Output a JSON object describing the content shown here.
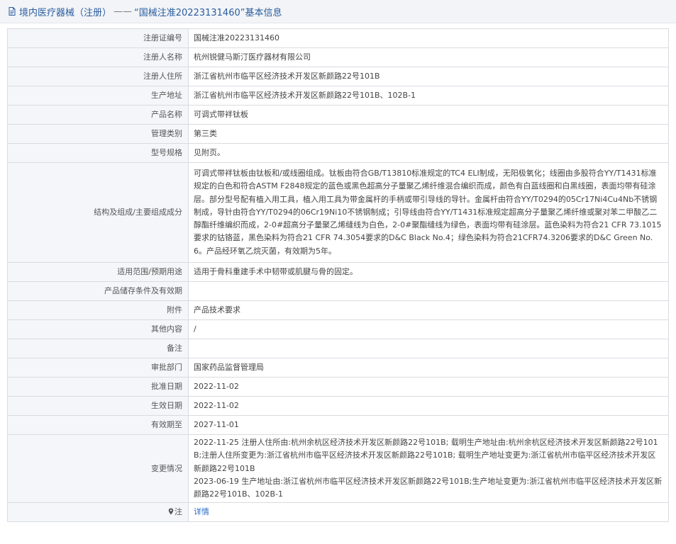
{
  "header": {
    "title": "境内医疗器械（注册）",
    "separator": "——",
    "subtitle": "“国械注准20223131460”基本信息"
  },
  "rows": [
    {
      "label": "注册证编号",
      "value": "国械注准20223131460"
    },
    {
      "label": "注册人名称",
      "value": "杭州锐健马斯汀医疗器材有限公司"
    },
    {
      "label": "注册人住所",
      "value": "浙江省杭州市临平区经济技术开发区新颜路22号101B"
    },
    {
      "label": "生产地址",
      "value": "浙江省杭州市临平区经济技术开发区新颜路22号101B、102B-1"
    },
    {
      "label": "产品名称",
      "value": "可调式带袢钛板"
    },
    {
      "label": "管理类别",
      "value": "第三类"
    },
    {
      "label": "型号规格",
      "value": "见附页。"
    },
    {
      "label": "结构及组成/主要组成成分",
      "value": "可调式带袢钛板由钛板和/或线圈组成。钛板由符合GB/T13810标准规定的TC4 ELI制成，无阳极氧化；线圈由多股符合YY/T1431标准规定的白色和符合ASTM F2848规定的蓝色或黑色超高分子量聚乙烯纤维混合编织而成，颜色有白蓝线圈和白黑线圈，表面均带有硅涂层。部分型号配有植入用工具，植入用工具为带金属杆的手柄或带引导线的导针。金属杆由符合YY/T0294的05Cr17Ni4Cu4Nb不锈钢制成，导针由符合YY/T0294的06Cr19Ni10不锈钢制成；引导线由符合YY/T1431标准规定超高分子量聚乙烯纤维或聚对苯二甲酸乙二醇酯纤维编织而成，2-0#超高分子量聚乙烯缝线为白色，2-0#聚酯缝线为绿色，表面均带有硅涂层。蓝色染料为符合21 CFR 73.1015要求的钴铬蓝，黑色染料为符合21 CFR 74.3054要求的D&C Black No.4；绿色染料为符合21CFR74.3206要求的D&C Green No.6。产品经环氧乙烷灭菌，有效期为5年。"
    },
    {
      "label": "适用范围/预期用途",
      "value": "适用于骨科重建手术中韧带或肌腱与骨的固定。"
    },
    {
      "label": "产品储存条件及有效期",
      "value": ""
    },
    {
      "label": "附件",
      "value": "产品技术要求"
    },
    {
      "label": "其他内容",
      "value": "/"
    },
    {
      "label": "备注",
      "value": ""
    },
    {
      "label": "审批部门",
      "value": "国家药品监督管理局"
    },
    {
      "label": "批准日期",
      "value": "2022-11-02"
    },
    {
      "label": "生效日期",
      "value": "2022-11-02"
    },
    {
      "label": "有效期至",
      "value": "2027-11-01"
    },
    {
      "label": "变更情况",
      "value": "2022-11-25 注册人住所由:杭州余杭区经济技术开发区新颜路22号101B; 载明生产地址由:杭州余杭区经济技术开发区新颜路22号101B;注册人住所变更为:浙江省杭州市临平区经济技术开发区新颜路22号101B; 载明生产地址变更为:浙江省杭州市临平区经济技术开发区新颜路22号101B",
      "value2": "2023-06-19 生产地址由:浙江省杭州市临平区经济技术开发区新颜路22号101B;生产地址变更为:浙江省杭州市临平区经济技术开发区新颜路22号101B、102B-1"
    },
    {
      "label": "注",
      "value": "详情"
    }
  ],
  "colors": {
    "accent": "#2a5d9f",
    "link": "#2a6cc4",
    "label_bg": "#f4f6f9",
    "border": "#d8dbe0"
  },
  "icons": {
    "header": "document-icon",
    "note": "map-pin-icon"
  }
}
